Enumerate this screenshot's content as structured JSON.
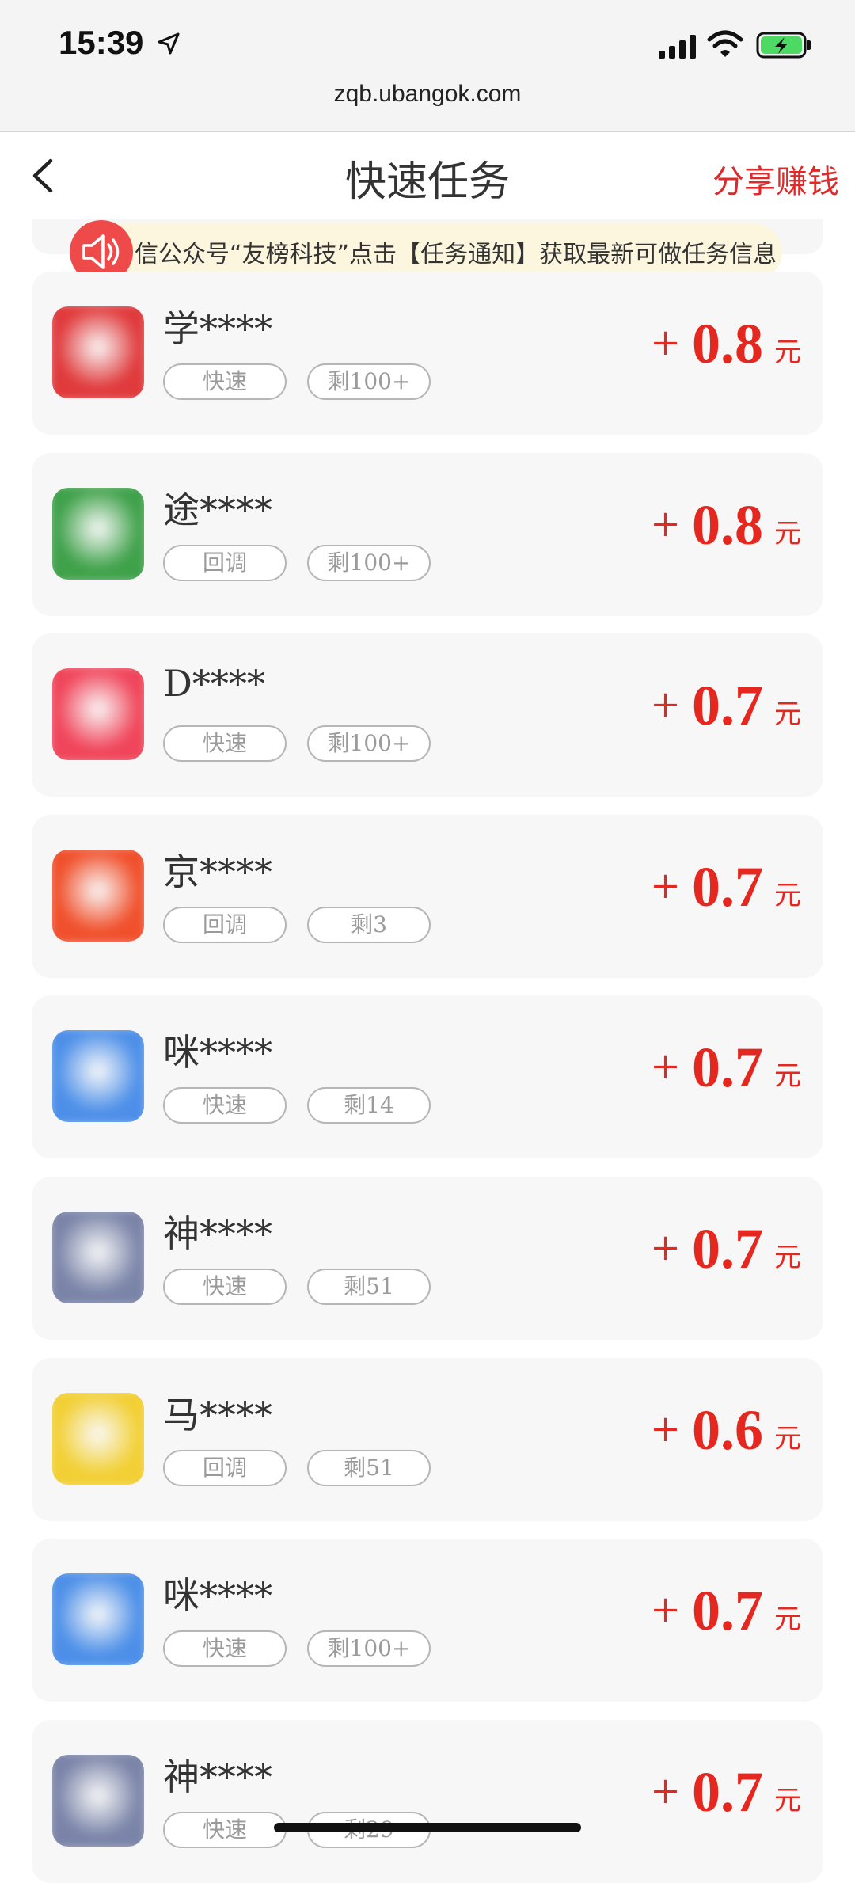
{
  "status_bar": {
    "time": "15:39"
  },
  "browser": {
    "url": "zqb.ubangok.com"
  },
  "nav": {
    "title": "快速任务",
    "share": "分享赚钱"
  },
  "notice": {
    "text": "信公众号“友榜科技”点击【任务通知】获取最新可做任务信息"
  },
  "tasks": [
    {
      "name": "学****",
      "tag": "快速",
      "remaining": "剩100+",
      "plus": "+",
      "amount": "0.8",
      "unit": "元",
      "icon_color": "#e03a3c"
    },
    {
      "name": "途****",
      "tag": "回调",
      "remaining": "剩100+",
      "plus": "+",
      "amount": "0.8",
      "unit": "元",
      "icon_color": "#3fa14a"
    },
    {
      "name": "D****",
      "tag": "快速",
      "remaining": "剩100+",
      "plus": "+",
      "amount": "0.7",
      "unit": "元",
      "icon_color": "#f0455a"
    },
    {
      "name": "京****",
      "tag": "回调",
      "remaining": "剩3",
      "plus": "+",
      "amount": "0.7",
      "unit": "元",
      "icon_color": "#f0502c"
    },
    {
      "name": "咪****",
      "tag": "快速",
      "remaining": "剩14",
      "plus": "+",
      "amount": "0.7",
      "unit": "元",
      "icon_color": "#4d8fe8"
    },
    {
      "name": "神****",
      "tag": "快速",
      "remaining": "剩51",
      "plus": "+",
      "amount": "0.7",
      "unit": "元",
      "icon_color": "#7a84a8"
    },
    {
      "name": "马****",
      "tag": "回调",
      "remaining": "剩51",
      "plus": "+",
      "amount": "0.6",
      "unit": "元",
      "icon_color": "#f2cf34"
    },
    {
      "name": "咪****",
      "tag": "快速",
      "remaining": "剩100+",
      "plus": "+",
      "amount": "0.7",
      "unit": "元",
      "icon_color": "#4d8fe8"
    },
    {
      "name": "神****",
      "tag": "快速",
      "remaining": "剩29",
      "plus": "+",
      "amount": "0.7",
      "unit": "元",
      "icon_color": "#7a84a8"
    }
  ],
  "colors": {
    "accent": "#e5281f",
    "share": "#e02a2a",
    "notice_bg": "#fdf6de"
  }
}
